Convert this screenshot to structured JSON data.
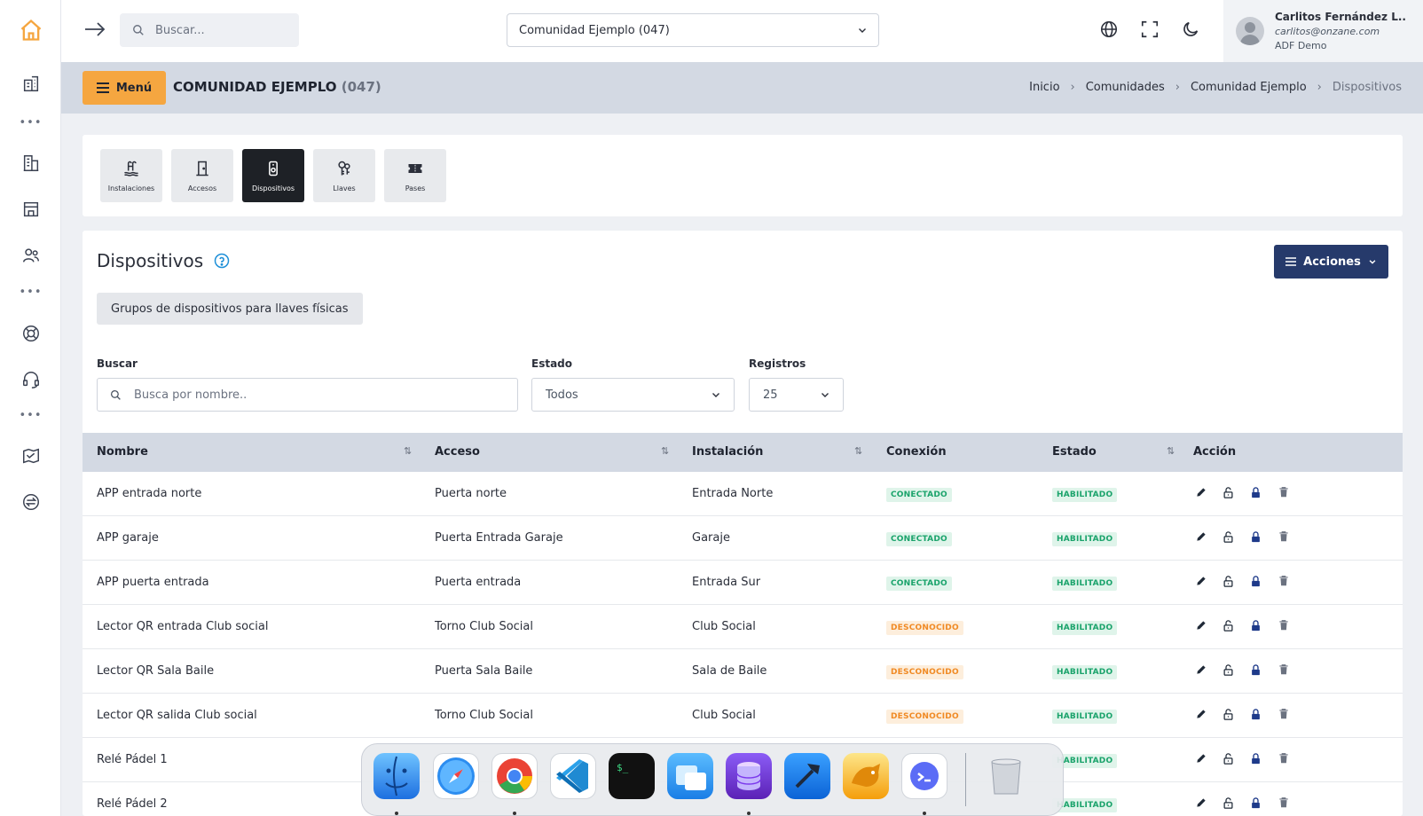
{
  "topbar": {
    "search_placeholder": "Buscar...",
    "community_selected": "Comunidad Ejemplo (047)",
    "user": {
      "name": "Carlitos Fernández L..",
      "email": "carlitos@onzane.com",
      "org": "ADF Demo"
    }
  },
  "subheader": {
    "menu_label": "Menú",
    "title": "COMUNIDAD EJEMPLO",
    "title_code": "(047)",
    "breadcrumb": [
      "Inicio",
      "Comunidades",
      "Comunidad Ejemplo",
      "Dispositivos"
    ]
  },
  "tabs": [
    {
      "label": "Instalaciones",
      "icon": "pool-icon",
      "active": false
    },
    {
      "label": "Accesos",
      "icon": "door-icon",
      "active": false
    },
    {
      "label": "Dispositivos",
      "icon": "device-icon",
      "active": true
    },
    {
      "label": "Llaves",
      "icon": "keys-icon",
      "active": false
    },
    {
      "label": "Pases",
      "icon": "ticket-icon",
      "active": false
    }
  ],
  "section": {
    "title": "Dispositivos",
    "actions_label": "Acciones",
    "groups_button": "Grupos de dispositivos para llaves físicas"
  },
  "filters": {
    "search_label": "Buscar",
    "search_placeholder": "Busca por nombre..",
    "state_label": "Estado",
    "state_value": "Todos",
    "records_label": "Registros",
    "records_value": "25"
  },
  "table": {
    "headers": [
      "Nombre",
      "Acceso",
      "Instalación",
      "Conexión",
      "Estado",
      "Acción"
    ],
    "rows": [
      {
        "nombre": "APP entrada norte",
        "acceso": "Puerta norte",
        "instalacion": "Entrada Norte",
        "conexion": "CONECTADO",
        "estado": "HABILITADO"
      },
      {
        "nombre": "APP garaje",
        "acceso": "Puerta Entrada Garaje",
        "instalacion": "Garaje",
        "conexion": "CONECTADO",
        "estado": "HABILITADO"
      },
      {
        "nombre": "APP puerta entrada",
        "acceso": "Puerta entrada",
        "instalacion": "Entrada Sur",
        "conexion": "CONECTADO",
        "estado": "HABILITADO"
      },
      {
        "nombre": "Lector QR entrada Club social",
        "acceso": "Torno Club Social",
        "instalacion": "Club Social",
        "conexion": "DESCONOCIDO",
        "estado": "HABILITADO"
      },
      {
        "nombre": "Lector QR Sala Baile",
        "acceso": "Puerta Sala Baile",
        "instalacion": "Sala de Baile",
        "conexion": "DESCONOCIDO",
        "estado": "HABILITADO"
      },
      {
        "nombre": "Lector QR salida Club social",
        "acceso": "Torno Club Social",
        "instalacion": "Club Social",
        "conexion": "DESCONOCIDO",
        "estado": "HABILITADO"
      },
      {
        "nombre": "Relé Pádel 1",
        "acceso": "",
        "instalacion": "",
        "conexion": "",
        "estado": "HABILITADO"
      },
      {
        "nombre": "Relé Pádel 2",
        "acceso": "",
        "instalacion": "",
        "conexion": "",
        "estado": "HABILITADO"
      }
    ]
  },
  "colors": {
    "accent_orange": "#f5a640",
    "primary_navy": "#263a6b",
    "status_green": "#1aa36b",
    "status_orange": "#f08a24"
  },
  "dock": {
    "apps": [
      "finder-icon",
      "safari-icon",
      "chrome-icon",
      "vscode-icon",
      "terminal-icon",
      "windows-app-icon",
      "database-icon",
      "xcode-icon",
      "sequel-icon",
      "chat-icon",
      "trash-icon"
    ]
  }
}
